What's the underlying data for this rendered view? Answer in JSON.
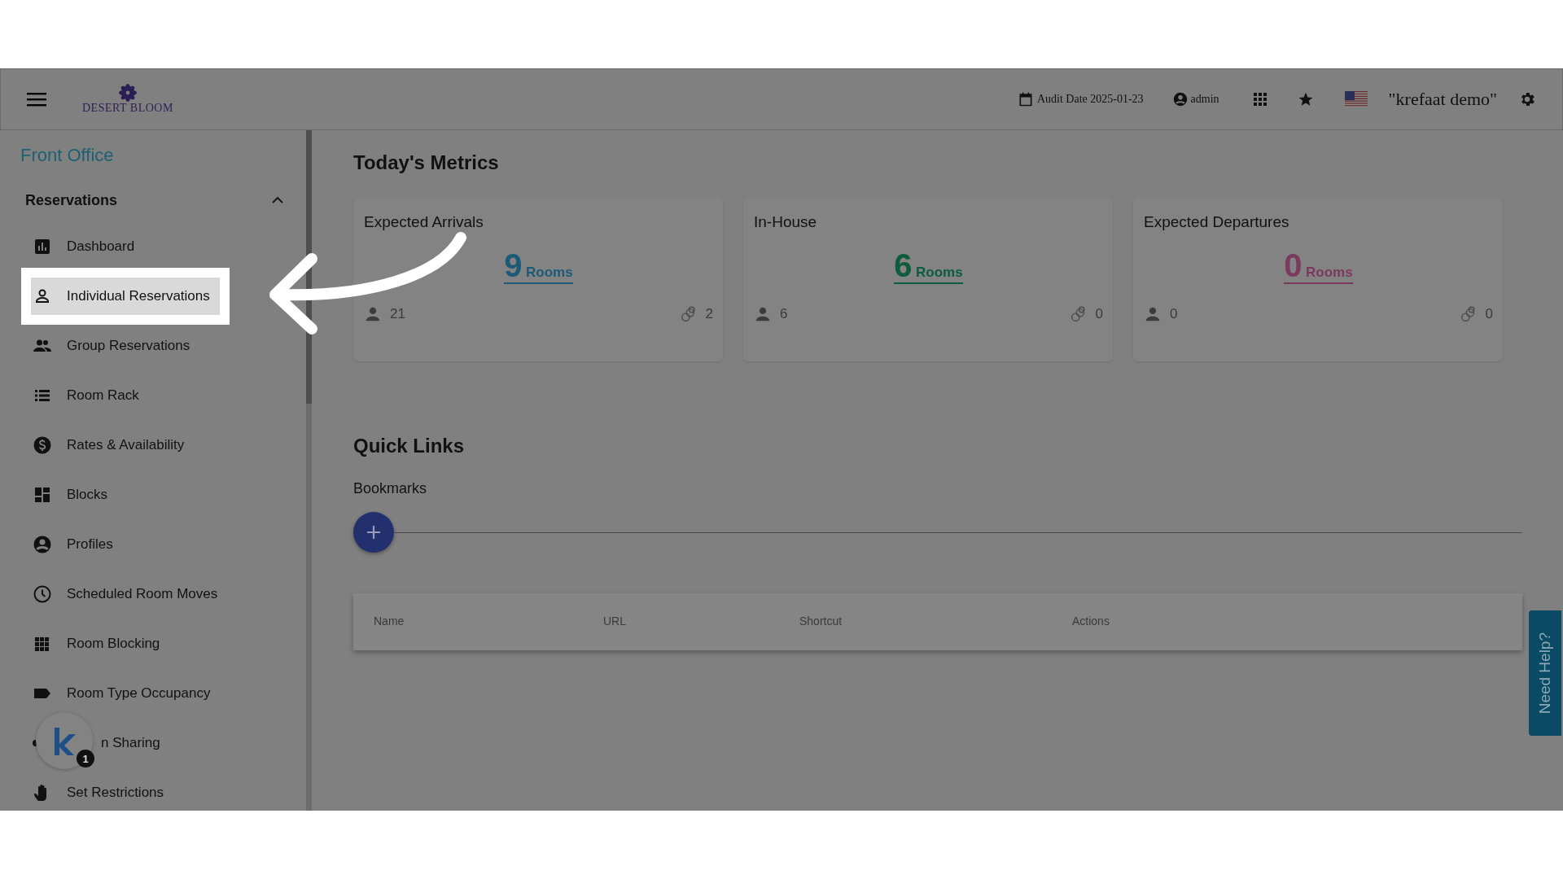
{
  "header": {
    "logo": "DESERT BLOOM",
    "audit_date": "Audit Date 2025-01-23",
    "user": "admin",
    "property": "\"krefaat demo\""
  },
  "sidebar": {
    "title": "Front Office",
    "section": {
      "label": "Reservations",
      "expanded": true
    },
    "items": [
      {
        "label": "Dashboard",
        "selected": false
      },
      {
        "label": "Individual Reservations",
        "selected": true
      },
      {
        "label": "Group Reservations",
        "selected": false
      },
      {
        "label": "Room Rack",
        "selected": false
      },
      {
        "label": "Rates & Availability",
        "selected": false
      },
      {
        "label": "Blocks",
        "selected": false
      },
      {
        "label": "Profiles",
        "selected": false
      },
      {
        "label": "Scheduled Room Moves",
        "selected": false
      },
      {
        "label": "Room Blocking",
        "selected": false
      },
      {
        "label": "Room Type Occupancy",
        "selected": false
      },
      {
        "label": "n Sharing",
        "selected": false,
        "kind": "covered"
      },
      {
        "label": "Set Restrictions",
        "selected": false
      }
    ]
  },
  "metrics": {
    "title": "Today's Metrics",
    "cards": [
      {
        "title": "Expected Arrivals",
        "count": "9",
        "unit": "Rooms",
        "color": "#1c5a78",
        "guests": "21",
        "linked": "2"
      },
      {
        "title": "In-House",
        "count": "6",
        "unit": "Rooms",
        "color": "#0d5c3e",
        "guests": "6",
        "linked": "0"
      },
      {
        "title": "Expected Departures",
        "count": "0",
        "unit": "Rooms",
        "color": "#7a3a5e",
        "guests": "0",
        "linked": "0"
      }
    ]
  },
  "quick_links": {
    "title": "Quick Links",
    "subtitle": "Bookmarks",
    "table": {
      "columns": [
        "Name",
        "URL",
        "Shortcut",
        "Actions"
      ]
    }
  },
  "help_tab": "Need Help?",
  "widget": {
    "badge": "1"
  }
}
